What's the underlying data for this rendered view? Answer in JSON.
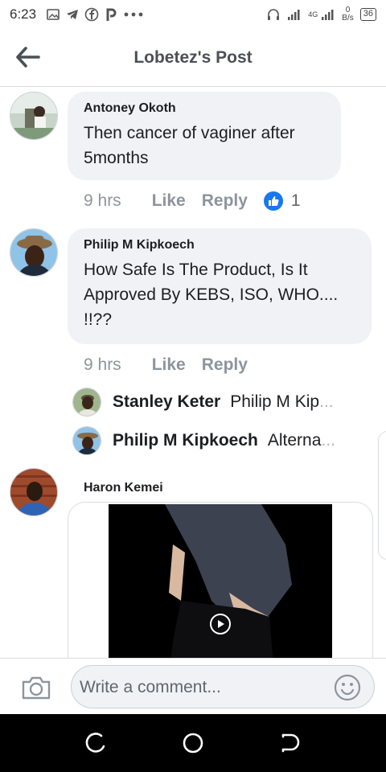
{
  "status_bar": {
    "time": "6:23",
    "network": "4G",
    "net_speed_value": "0",
    "net_speed_unit": "B/s",
    "battery": "36"
  },
  "header": {
    "title": "Lobetez's Post"
  },
  "comments": [
    {
      "author": "Antoney Okoth",
      "text": "Then cancer of vaginer after 5months",
      "time": "9 hrs",
      "like_label": "Like",
      "reply_label": "Reply",
      "reaction_count": "1"
    },
    {
      "author": "Philip M Kipkoech",
      "text": "How Safe Is The Product, Is It Approved By KEBS, ISO, WHO.... !!??",
      "time": "9 hrs",
      "like_label": "Like",
      "reply_label": "Reply",
      "replies": [
        {
          "author": "Stanley Keter",
          "preview_text": "Philip M Kip",
          "preview_fade": "..."
        },
        {
          "author": "Philip M Kipkoech",
          "preview_text": "Alterna",
          "preview_fade": "..."
        }
      ]
    },
    {
      "author": "Haron Kemei",
      "media": "video"
    }
  ],
  "composer": {
    "placeholder": "Write a comment..."
  },
  "icons": {
    "back": "arrow-left-icon",
    "camera": "camera-icon",
    "emoji": "smiley-icon",
    "like_reaction": "thumbs-up-icon",
    "play": "play-icon"
  },
  "colors": {
    "facebook_blue": "#1877f2",
    "bubble_bg": "#f0f2f5",
    "meta_gray": "#8d949e"
  }
}
